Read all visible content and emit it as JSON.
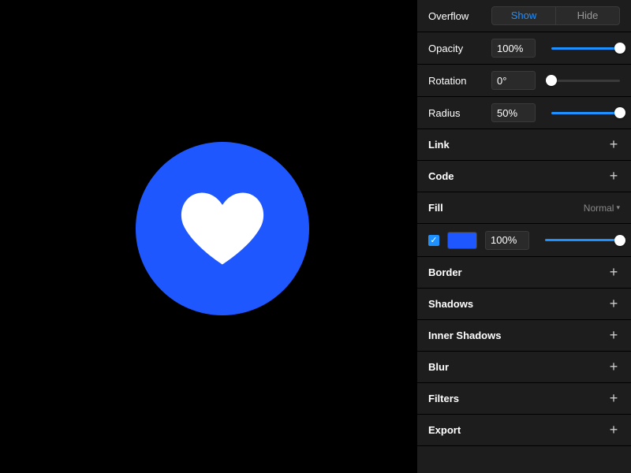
{
  "canvas": {
    "circle_color": "#1f57ff",
    "heart_color": "#ffffff"
  },
  "inspector": {
    "overflow": {
      "label": "Overflow",
      "show": "Show",
      "hide": "Hide",
      "active": "show"
    },
    "opacity": {
      "label": "Opacity",
      "value": "100%",
      "pct": 100
    },
    "rotation": {
      "label": "Rotation",
      "value": "0°",
      "pct": 0
    },
    "radius": {
      "label": "Radius",
      "value": "50%",
      "pct": 100
    },
    "link": {
      "label": "Link"
    },
    "code": {
      "label": "Code"
    },
    "fill": {
      "label": "Fill",
      "blend": "Normal",
      "opacity": "100%",
      "opacity_pct": 100,
      "color": "#1f57ff",
      "checked": true
    },
    "border": {
      "label": "Border"
    },
    "shadows": {
      "label": "Shadows"
    },
    "inner": {
      "label": "Inner Shadows"
    },
    "blur": {
      "label": "Blur"
    },
    "filters": {
      "label": "Filters"
    },
    "export": {
      "label": "Export"
    }
  }
}
